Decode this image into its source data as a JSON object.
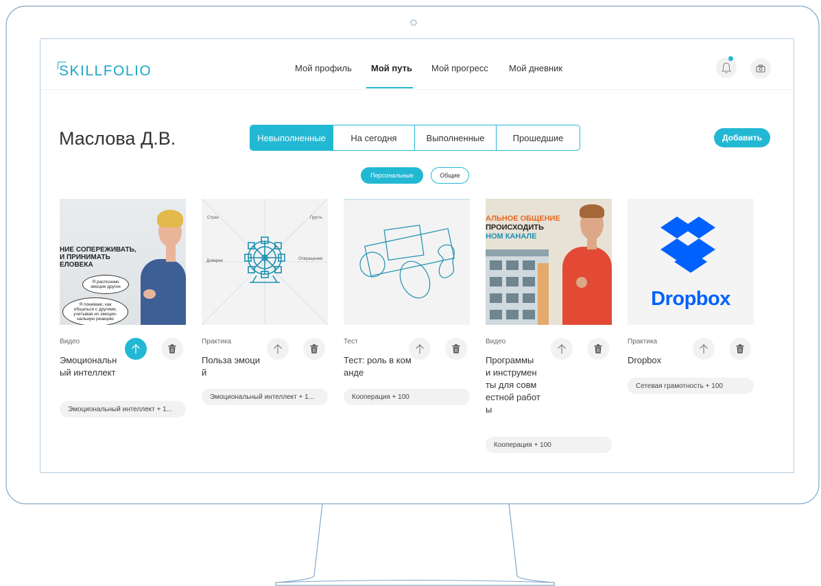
{
  "app": {
    "logo": "SKILLFOLIO"
  },
  "nav": {
    "items": [
      "Мой профиль",
      "Мой путь",
      "Мой прогресс",
      "Мой дневник"
    ],
    "active": "Мой путь"
  },
  "header_icons": [
    "bell-icon",
    "camera-icon"
  ],
  "page": {
    "title": "Маслова Д.В.",
    "add_label": "Добавить"
  },
  "filters": {
    "segments": [
      "Невыполненные",
      "На сегодня",
      "Выполненные",
      "Прошедшие"
    ],
    "active_segment": "Невыполненные",
    "pills": [
      "Персональные",
      "Общие"
    ],
    "active_pill": "Персональные"
  },
  "colors": {
    "accent": "#22b8d3",
    "logo": "#1ba6c7",
    "dropbox": "#0061fe",
    "orange_text": "#e8661b"
  },
  "cards": [
    {
      "type": "Видео",
      "title": "Эмоциональный интеллект",
      "tag": "Эмоциональный интеллект + 1...",
      "thumb": {
        "lines": [
          "НИЕ СОПЕРЕЖИВАТЬ,",
          "И ПРИНИМАТЬ",
          "ЕЛОВЕКА"
        ],
        "bubble1": "Я распознаю эмоции других",
        "bubble2": "Я понимаю, как общаться с другими, учитывая их эмоцио- нальную реакцию"
      },
      "upload_active": true
    },
    {
      "type": "Практика",
      "title": "Польза эмоций",
      "tag": "Эмоциональный интеллект + 1...",
      "thumb": {
        "labels": [
          "Страх",
          "Грусть",
          "Доверие",
          "Отвращение"
        ]
      },
      "upload_active": false
    },
    {
      "type": "Тест",
      "title": "Тест: роль в команде",
      "tag": "Кооперация + 100",
      "upload_active": false
    },
    {
      "type": "Видео",
      "title": "Программы и инструменты для совместной работы",
      "tag": "Кооперация + 100",
      "thumb": {
        "lines": [
          "АЛЬНОЕ ОБЩЕНИЕ",
          "ПРОИСХОДИТЬ",
          "НОМ КАНАЛЕ"
        ]
      },
      "upload_active": false
    },
    {
      "type": "Практика",
      "title": "Dropbox",
      "tag": "Сетевая грамотность + 100",
      "thumb": {
        "wordmark": "Dropbox"
      },
      "upload_active": false
    }
  ]
}
